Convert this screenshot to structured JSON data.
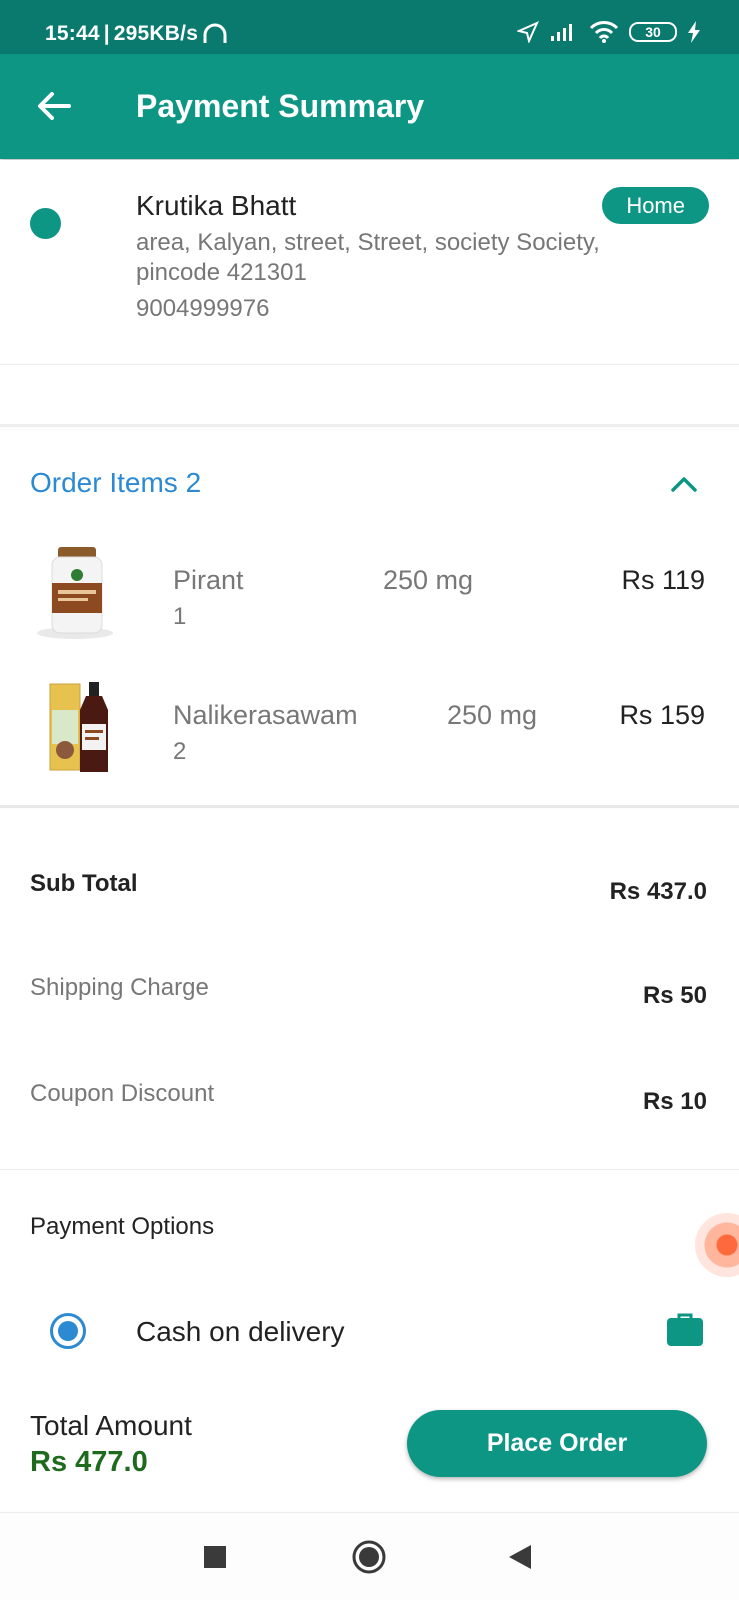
{
  "status": {
    "time": "15:44",
    "speed": "295KB/s",
    "battery": "30"
  },
  "header": {
    "title": "Payment Summary"
  },
  "address": {
    "name": "Krutika Bhatt",
    "tag": "Home",
    "line": "area, Kalyan, street, Street, society Society, pincode 421301",
    "phone": "9004999976"
  },
  "order": {
    "title": "Order Items 2",
    "items": [
      {
        "name": "Pirant",
        "dose": "250 mg",
        "qty": "1",
        "price": "Rs 119"
      },
      {
        "name": "Nalikerasawam",
        "dose": "250 mg",
        "qty": "2",
        "price": "Rs 159"
      }
    ]
  },
  "totals": {
    "subtotal_label": "Sub Total",
    "subtotal_value": "Rs 437.0",
    "shipping_label": "Shipping Charge",
    "shipping_value": "Rs 50",
    "coupon_label": "Coupon Discount",
    "coupon_value": "Rs 10"
  },
  "payment": {
    "title": "Payment Options",
    "option": "Cash on delivery",
    "selected": true
  },
  "footer": {
    "total_label": "Total Amount",
    "total_value": "Rs 477.0",
    "place_order": "Place Order"
  },
  "colors": {
    "primary": "#0e9685",
    "status_bar": "#0b7a6e",
    "link": "#2b8ad2",
    "total_green": "#1e6b1e"
  },
  "icons": {
    "back": "arrow-left-icon",
    "collapse": "chevron-up-icon",
    "wallet": "briefcase-icon"
  }
}
